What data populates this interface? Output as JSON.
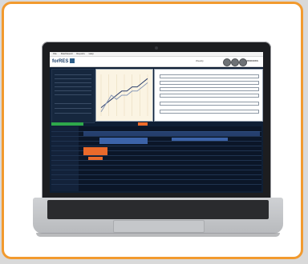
{
  "app": {
    "menu": [
      "File",
      "Dashboard",
      "Reports",
      "Help"
    ],
    "logo_text": "forRES",
    "logo_accent": "RES",
    "header_mid": "Weekly",
    "header_right": "WINDOWS"
  },
  "colors": {
    "frame_border": "#f29a2e",
    "workspace_bg": "#0f1f35",
    "accent_green": "#2ea84b",
    "accent_orange": "#ea6a2b",
    "accent_blue": "#3c63a8"
  },
  "chart_data": {
    "type": "line",
    "series": [
      {
        "values": [
          2,
          3,
          4,
          5,
          6,
          6,
          7,
          7,
          8,
          9
        ]
      },
      {
        "values": [
          1,
          3,
          5,
          4,
          5,
          5,
          6,
          6,
          7,
          8
        ]
      }
    ],
    "x": [
      1,
      2,
      3,
      4,
      5,
      6,
      7,
      8,
      9,
      10
    ],
    "ylim": [
      0,
      10
    ]
  }
}
